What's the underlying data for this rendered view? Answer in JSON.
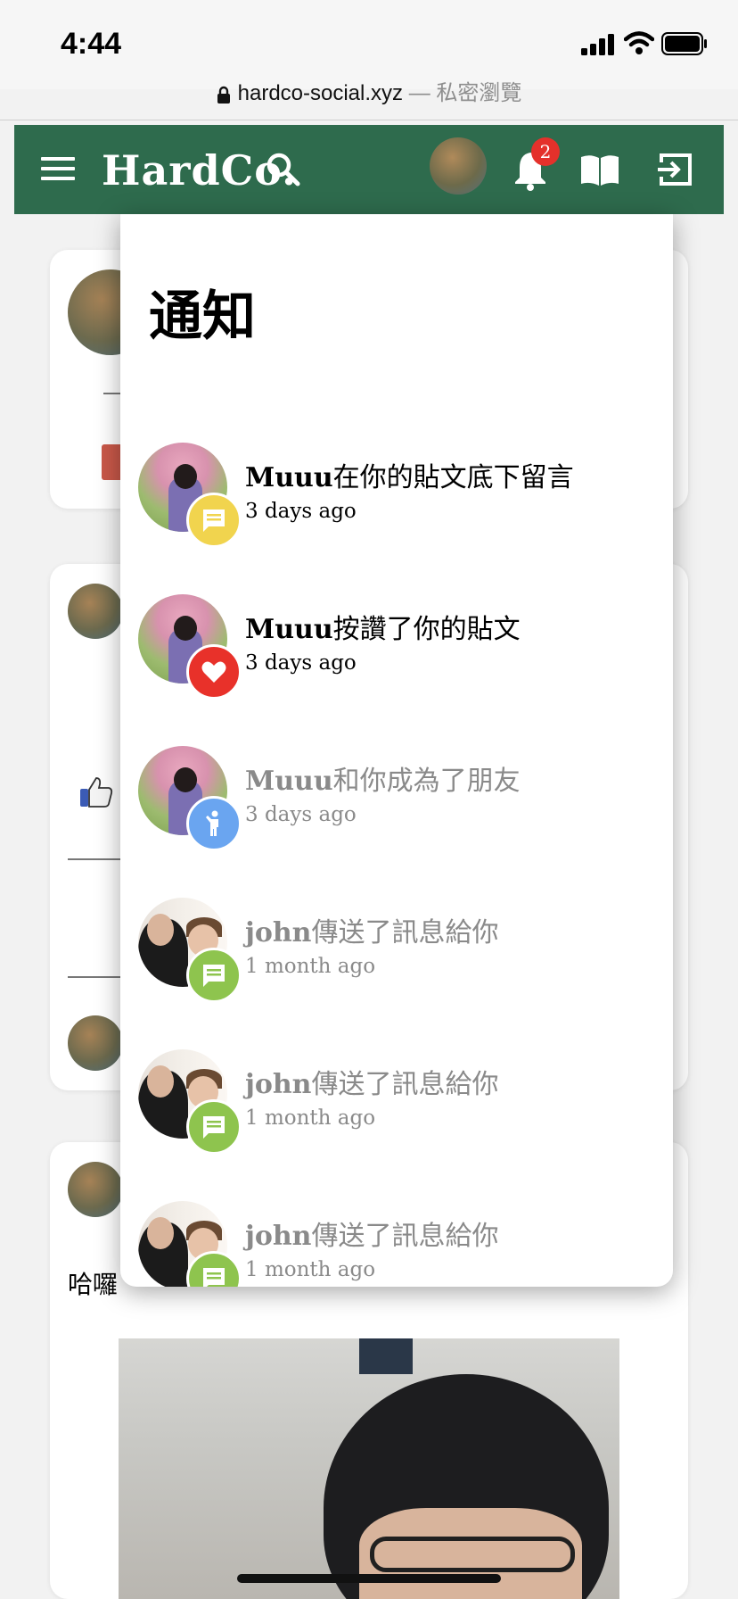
{
  "status_bar": {
    "time": "4:44"
  },
  "browser": {
    "url": "hardco-social.xyz",
    "private_label": "— 私密瀏覽"
  },
  "header": {
    "brand": "HardCo.",
    "notification_count": "2"
  },
  "notifications": {
    "title": "通知",
    "items": [
      {
        "name": "Muuu",
        "action": "在你的貼文底下留言",
        "time": "3 days ago",
        "type": "comment",
        "read": false
      },
      {
        "name": "Muuu",
        "action": "按讚了你的貼文",
        "time": "3 days ago",
        "type": "like",
        "read": false
      },
      {
        "name": "Muuu",
        "action": "和你成為了朋友",
        "time": "3 days ago",
        "type": "friend",
        "read": true
      },
      {
        "name": "john",
        "action": "傳送了訊息給你",
        "time": "1 month ago",
        "type": "message",
        "read": true
      },
      {
        "name": "john",
        "action": "傳送了訊息給你",
        "time": "1 month ago",
        "type": "message",
        "read": true
      },
      {
        "name": "john",
        "action": "傳送了訊息給你",
        "time": "1 month ago",
        "type": "message",
        "read": true
      }
    ]
  },
  "feed": {
    "post_text": "哈囉"
  },
  "colors": {
    "header_bg": "#2e6b4d",
    "badge_red": "#e4312b",
    "comment": "#f1d44e",
    "like": "#e8312a",
    "friend": "#6aa5f0",
    "message": "#8ec44e"
  }
}
